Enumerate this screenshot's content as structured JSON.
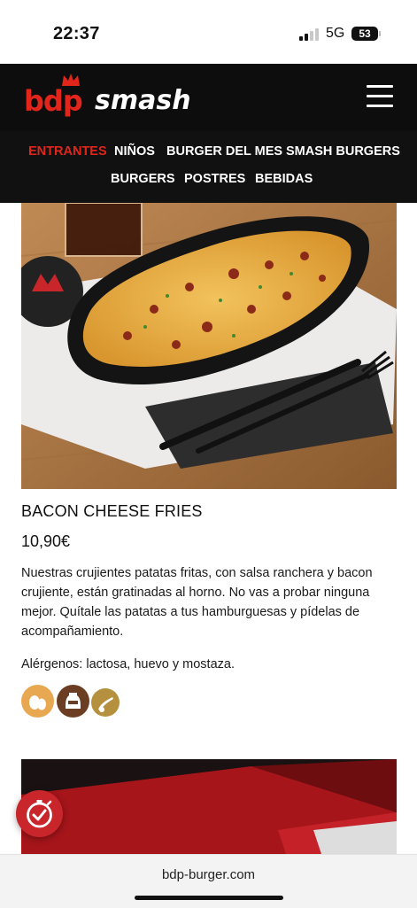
{
  "status_bar": {
    "time": "22:37",
    "network": "5G",
    "battery": "53"
  },
  "header": {
    "logo_bdp": "bdp",
    "logo_smash": "smash",
    "menu_icon": "hamburger-menu-icon"
  },
  "categories": [
    {
      "label": "ENTRANTES",
      "active": true
    },
    {
      "label": "NIÑOS",
      "active": false
    },
    {
      "label": "BURGER DEL MES",
      "active": false
    },
    {
      "label": "SMASH BURGERS",
      "active": false
    },
    {
      "label": "BURGERS",
      "active": false
    },
    {
      "label": "POSTRES",
      "active": false
    },
    {
      "label": "BEBIDAS",
      "active": false
    }
  ],
  "product": {
    "title": "BACON CHEESE FRIES",
    "price": "10,90€",
    "description": "Nuestras crujientes patatas fritas, con salsa ranchera y bacon crujiente, están gratinadas al horno. No vas a probar ninguna mejor. Quítale las patatas a tus hamburguesas y pídelas de acompañamiento.",
    "allergens_text": "Alérgenos: lactosa, huevo y mostaza.",
    "allergen_icons": [
      {
        "name": "egg-allergen-icon",
        "color": "#e7a851"
      },
      {
        "name": "milk-allergen-icon",
        "color": "#6b3d22"
      },
      {
        "name": "mustard-allergen-icon",
        "color": "#b5913f"
      }
    ]
  },
  "fab": {
    "icon": "stopwatch-check-icon"
  },
  "browser": {
    "url": "bdp-burger.com"
  },
  "colors": {
    "brand_red": "#e1251b",
    "header_bg": "#0d0d0d",
    "nav_bg": "#111111"
  }
}
